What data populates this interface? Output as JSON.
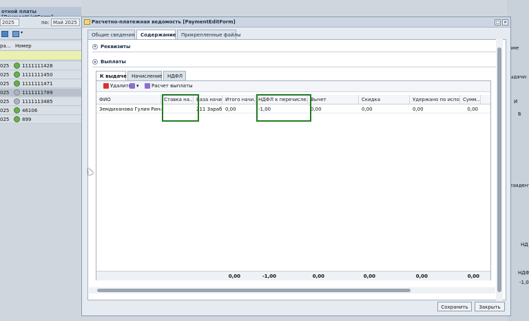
{
  "background": {
    "title": "отной платы [PaymentListForm]",
    "filter": {
      "from_value": "2025",
      "to_label": "по:",
      "to_value": "Май 2025"
    },
    "columns": [
      "ра...",
      "Номер"
    ],
    "rows": [
      {
        "year": "025",
        "number": "1111111428",
        "status": "green"
      },
      {
        "year": "025",
        "number": "1111111450",
        "status": "green"
      },
      {
        "year": "025",
        "number": "1111111471",
        "status": "green"
      },
      {
        "year": "025",
        "number": "1111111789",
        "status": "gray"
      },
      {
        "year": "025",
        "number": "1111113485",
        "status": "gray"
      },
      {
        "year": "025",
        "number": "46106",
        "status": "green"
      },
      {
        "year": "025",
        "number": "899",
        "status": "green"
      }
    ],
    "right_texts": [
      "зме",
      "ыдачи:",
      "И",
      "Б",
      "езидента",
      "НД",
      "НДФ",
      "-1,00"
    ]
  },
  "window": {
    "title": "Расчетно-платежная ведомость [PaymentEditForm]",
    "tabs": [
      "Общие сведения",
      "Содержание",
      "Прикрепленные файлы"
    ],
    "active_tab": "Содержание",
    "sections": {
      "requisites": "Реквизиты",
      "payments": "Выплаты"
    },
    "inner_tabs": [
      "К выдаче",
      "Начисление",
      "НДФЛ"
    ],
    "toolbar": {
      "delete_label": "Удалить",
      "calc_label": "Расчет выплаты"
    },
    "columns": [
      "ФИО",
      "Ставка на...",
      "База начи...",
      "Итого начи...",
      "НДФЛ к перечисле...",
      "Вычет",
      "Скидка",
      "Удержано по испол...",
      "Сумм..."
    ],
    "row": [
      "Земдиханова Гулия Рина...",
      "",
      "211 Зараб...",
      "0,00",
      "-1,00",
      "0,00",
      "0,00",
      "0,00",
      "0,00"
    ],
    "totals": [
      "0,00",
      "-1,00",
      "0,00",
      "0,00",
      "0,00",
      "0,00"
    ],
    "buttons": {
      "save": "Сохранить",
      "close": "Закрыть"
    }
  }
}
